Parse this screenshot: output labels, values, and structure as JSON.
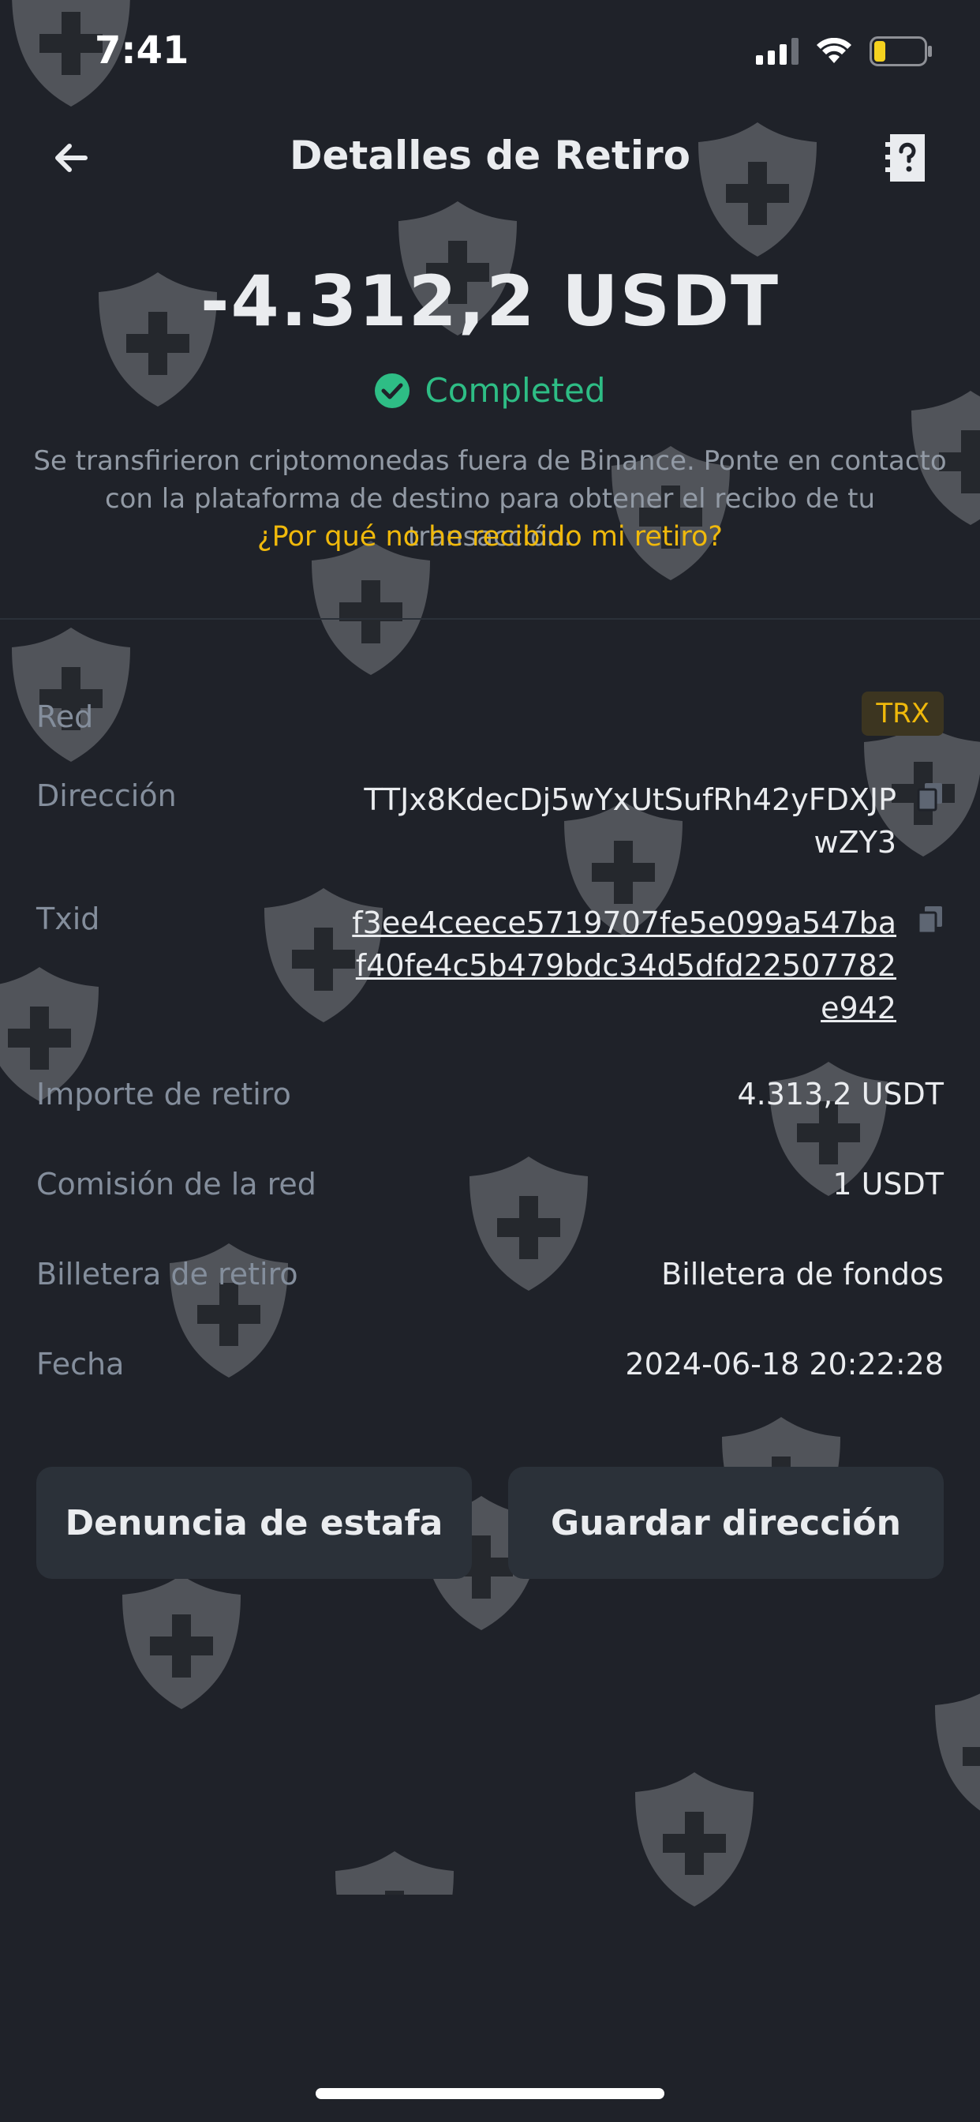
{
  "status_bar": {
    "time": "7:41"
  },
  "header": {
    "title": "Detalles de Retiro"
  },
  "summary": {
    "amount": "-4.312,2 USDT",
    "status": "Completed",
    "status_color": "#2ebd85",
    "notice": "Se transfirieron criptomonedas fuera de Binance. Ponte en contacto con la plataforma de destino para obtener el recibo de tu transacción.",
    "help_link": "¿Por qué no he recibido mi retiro?"
  },
  "details": {
    "network": {
      "label": "Red",
      "value": "TRX"
    },
    "address": {
      "label": "Dirección",
      "value": "TTJx8KdecDj5wYxUtSufRh42yFDXJPwZY3"
    },
    "txid": {
      "label": "Txid",
      "value": "f3ee4ceece5719707fe5e099a547baf40fe4c5b479bdc34d5dfd22507782e942"
    },
    "amount": {
      "label": "Importe de retiro",
      "value": "4.313,2 USDT"
    },
    "fee": {
      "label": "Comisión de la red",
      "value": "1 USDT"
    },
    "wallet": {
      "label": "Billetera de retiro",
      "value": "Billetera de fondos"
    },
    "date": {
      "label": "Fecha",
      "value": "2024-06-18 20:22:28"
    }
  },
  "actions": {
    "report_label": "Denuncia de estafa",
    "save_label": "Guardar dirección"
  },
  "colors": {
    "background": "#1f2229",
    "accent": "#f0b90b",
    "success": "#2ebd85",
    "muted": "#848e9c"
  }
}
